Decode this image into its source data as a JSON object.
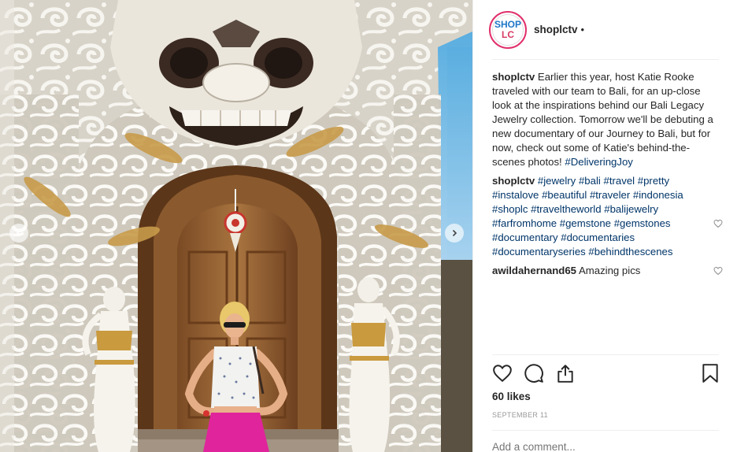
{
  "post": {
    "account": {
      "username": "shoplctv",
      "avatar_text_top": "SHOP",
      "avatar_text_bottom": "LC",
      "follow_dot": "•"
    },
    "caption": {
      "username": "shoplctv",
      "text": "Earlier this year, host Katie Rooke traveled with our team to Bali, for an up-close look at the inspirations behind our Bali Legacy Jewelry collection. Tomorrow we'll be debuting a new documentary of our Journey to Bali, but for now, check out some of Katie's behind-the-scenes photos!",
      "hashtag": "#DeliveringJoy"
    },
    "comments": [
      {
        "username": "shoplctv",
        "hashtags": [
          "#jewelry",
          "#bali",
          "#travel",
          "#pretty",
          "#instalove",
          "#beautiful",
          "#traveler",
          "#indonesia",
          "#shoplc",
          "#traveltheworld",
          "#balijewelry",
          "#farfromhome",
          "#gemstone",
          "#gemstones",
          "#documentary",
          "#documentaries",
          "#documentaryseries",
          "#behindthescenes"
        ]
      },
      {
        "username": "awildahernand65",
        "text": "Amazing pics"
      }
    ],
    "likes": "60 likes",
    "date": "September 11",
    "add_comment_placeholder": "Add a comment..."
  },
  "icons": {
    "like": "heart-icon",
    "comment": "comment-icon",
    "share": "share-icon",
    "save": "bookmark-icon",
    "prev": "chevron-left-icon",
    "next": "chevron-right-icon"
  },
  "colors": {
    "hashtag": "#003569",
    "avatar_ring": "#e1306c",
    "logo_blue": "#1e77c9",
    "logo_pink": "#d83b63",
    "skirt": "#e0249c"
  }
}
